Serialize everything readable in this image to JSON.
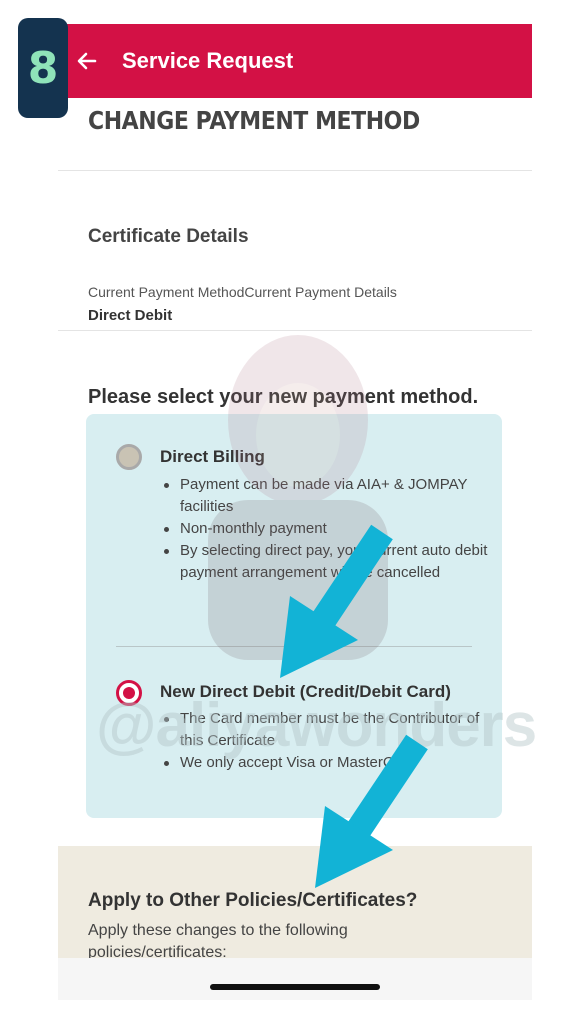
{
  "step": {
    "number": "8"
  },
  "appbar": {
    "title": "Service Request"
  },
  "page": {
    "heading": "CHANGE PAYMENT METHOD"
  },
  "certificate": {
    "section_title": "Certificate Details",
    "label": "Current Payment MethodCurrent Payment Details",
    "value": "Direct Debit"
  },
  "selection": {
    "prompt": "Please select your new payment method.",
    "options": [
      {
        "title": "Direct Billing",
        "selected": false,
        "bullets": [
          "Payment can be made via AIA+ & JOMPAY facilities",
          "Non-monthly payment",
          "By selecting direct pay, your current auto debit payment arrangement will be cancelled"
        ]
      },
      {
        "title": "New Direct Debit (Credit/Debit Card)",
        "selected": true,
        "bullets": [
          "The Card member must be the Contributor of this Certificate",
          "We only accept Visa or MasterCard"
        ]
      }
    ]
  },
  "apply": {
    "title": "Apply to Other Policies/Certificates?",
    "text": "Apply these changes to the following policies/certificates:"
  },
  "watermark": {
    "text": "@aliyawonders"
  },
  "colors": {
    "brand": "#d31145",
    "options_bg": "#d8eef1",
    "apply_bg": "#efebe0",
    "arrow": "#12b3d6",
    "badge_bg": "#14334f",
    "badge_text": "#8fe3b9"
  },
  "icons": {
    "back": "arrow-left-icon",
    "arrows": "annotation-arrow-icon"
  }
}
